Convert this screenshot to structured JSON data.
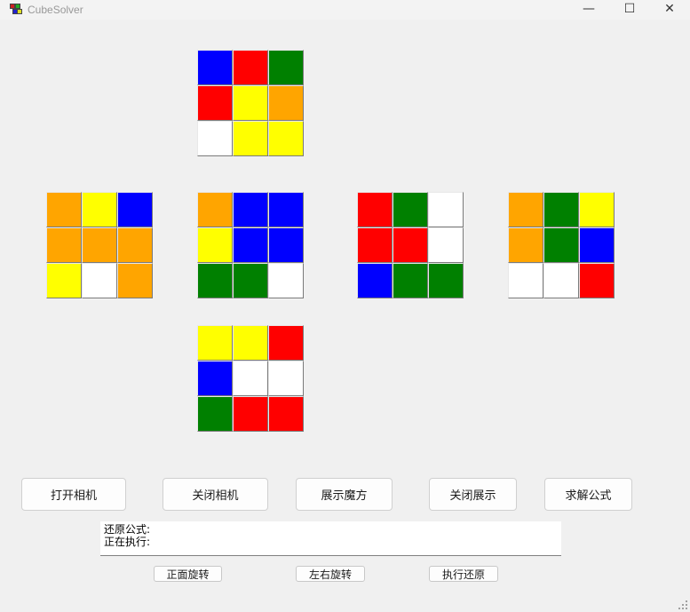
{
  "window": {
    "title": "CubeSolver",
    "minimize_glyph": "—",
    "maximize_glyph": "☐",
    "close_glyph": "✕"
  },
  "colors": {
    "blue": "#0000ff",
    "red": "#ff0000",
    "green": "#008000",
    "yellow": "#ffff00",
    "orange": "#ffa500",
    "white": "#ffffff"
  },
  "cube": {
    "up": [
      [
        "blue",
        "red",
        "green"
      ],
      [
        "red",
        "yellow",
        "orange"
      ],
      [
        "white",
        "yellow",
        "yellow"
      ]
    ],
    "left": [
      [
        "orange",
        "yellow",
        "blue"
      ],
      [
        "orange",
        "orange",
        "orange"
      ],
      [
        "yellow",
        "white",
        "orange"
      ]
    ],
    "front": [
      [
        "orange",
        "blue",
        "blue"
      ],
      [
        "yellow",
        "blue",
        "blue"
      ],
      [
        "green",
        "green",
        "white"
      ]
    ],
    "right": [
      [
        "red",
        "green",
        "white"
      ],
      [
        "red",
        "red",
        "white"
      ],
      [
        "blue",
        "green",
        "green"
      ]
    ],
    "back": [
      [
        "orange",
        "green",
        "yellow"
      ],
      [
        "orange",
        "green",
        "blue"
      ],
      [
        "white",
        "white",
        "red"
      ]
    ],
    "down": [
      [
        "yellow",
        "yellow",
        "red"
      ],
      [
        "blue",
        "white",
        "white"
      ],
      [
        "green",
        "red",
        "red"
      ]
    ]
  },
  "buttons": {
    "open_camera": "打开相机",
    "close_camera": "关闭相机",
    "show_cube": "展示魔方",
    "close_show": "关闭展示",
    "solve": "求解公式"
  },
  "info": {
    "formula_label": "还原公式:",
    "executing_label": "正在执行:"
  },
  "small_buttons": {
    "front_rotate": "正面旋转",
    "left_right_rotate": "左右旋转",
    "execute_restore": "执行还原"
  }
}
